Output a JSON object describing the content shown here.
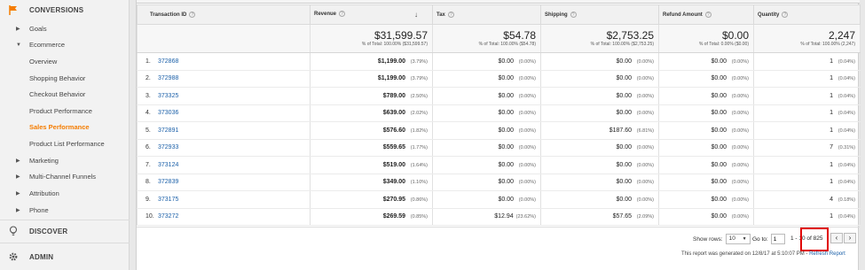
{
  "sidebar": {
    "conversions": "CONVERSIONS",
    "goals": "Goals",
    "ecommerce": "Ecommerce",
    "items": [
      "Overview",
      "Shopping Behavior",
      "Checkout Behavior",
      "Product Performance",
      "Sales Performance",
      "Product List Performance"
    ],
    "active_item": "Sales Performance",
    "marketing": "Marketing",
    "mcf": "Multi-Channel Funnels",
    "attribution": "Attribution",
    "phone": "Phone",
    "discover": "DISCOVER",
    "admin": "ADMIN"
  },
  "table": {
    "headers": [
      "Transaction ID",
      "Revenue",
      "Tax",
      "Shipping",
      "Refund Amount",
      "Quantity"
    ],
    "totals": [
      {
        "value": "$31,599.57",
        "pct": "% of Total: 100.00% ($31,599.57)"
      },
      {
        "value": "$54.78",
        "pct": "% of Total: 100.00% ($54.78)"
      },
      {
        "value": "$2,753.25",
        "pct": "% of Total: 100.00% ($2,753.25)"
      },
      {
        "value": "$0.00",
        "pct": "% of Total: 0.00% ($0.00)"
      },
      {
        "value": "2,247",
        "pct": "% of Total: 100.00% (2,247)"
      }
    ],
    "rows": [
      {
        "n": "1.",
        "id": "372868",
        "rev": "$1,199.00",
        "rev_p": "(3.79%)",
        "tax": "$0.00",
        "tax_p": "(0.00%)",
        "ship": "$0.00",
        "ship_p": "(0.00%)",
        "ref": "$0.00",
        "ref_p": "(0.00%)",
        "qty": "1",
        "qty_p": "(0.04%)"
      },
      {
        "n": "2.",
        "id": "372988",
        "rev": "$1,199.00",
        "rev_p": "(3.79%)",
        "tax": "$0.00",
        "tax_p": "(0.00%)",
        "ship": "$0.00",
        "ship_p": "(0.00%)",
        "ref": "$0.00",
        "ref_p": "(0.00%)",
        "qty": "1",
        "qty_p": "(0.04%)"
      },
      {
        "n": "3.",
        "id": "373325",
        "rev": "$789.00",
        "rev_p": "(2.50%)",
        "tax": "$0.00",
        "tax_p": "(0.00%)",
        "ship": "$0.00",
        "ship_p": "(0.00%)",
        "ref": "$0.00",
        "ref_p": "(0.00%)",
        "qty": "1",
        "qty_p": "(0.04%)"
      },
      {
        "n": "4.",
        "id": "373036",
        "rev": "$639.00",
        "rev_p": "(2.02%)",
        "tax": "$0.00",
        "tax_p": "(0.00%)",
        "ship": "$0.00",
        "ship_p": "(0.00%)",
        "ref": "$0.00",
        "ref_p": "(0.00%)",
        "qty": "1",
        "qty_p": "(0.04%)"
      },
      {
        "n": "5.",
        "id": "372891",
        "rev": "$576.60",
        "rev_p": "(1.82%)",
        "tax": "$0.00",
        "tax_p": "(0.00%)",
        "ship": "$187.60",
        "ship_p": "(6.81%)",
        "ref": "$0.00",
        "ref_p": "(0.00%)",
        "qty": "1",
        "qty_p": "(0.04%)"
      },
      {
        "n": "6.",
        "id": "372933",
        "rev": "$559.65",
        "rev_p": "(1.77%)",
        "tax": "$0.00",
        "tax_p": "(0.00%)",
        "ship": "$0.00",
        "ship_p": "(0.00%)",
        "ref": "$0.00",
        "ref_p": "(0.00%)",
        "qty": "7",
        "qty_p": "(0.31%)"
      },
      {
        "n": "7.",
        "id": "373124",
        "rev": "$519.00",
        "rev_p": "(1.64%)",
        "tax": "$0.00",
        "tax_p": "(0.00%)",
        "ship": "$0.00",
        "ship_p": "(0.00%)",
        "ref": "$0.00",
        "ref_p": "(0.00%)",
        "qty": "1",
        "qty_p": "(0.04%)"
      },
      {
        "n": "8.",
        "id": "372839",
        "rev": "$349.00",
        "rev_p": "(1.10%)",
        "tax": "$0.00",
        "tax_p": "(0.00%)",
        "ship": "$0.00",
        "ship_p": "(0.00%)",
        "ref": "$0.00",
        "ref_p": "(0.00%)",
        "qty": "1",
        "qty_p": "(0.04%)"
      },
      {
        "n": "9.",
        "id": "373175",
        "rev": "$270.95",
        "rev_p": "(0.86%)",
        "tax": "$0.00",
        "tax_p": "(0.00%)",
        "ship": "$0.00",
        "ship_p": "(0.00%)",
        "ref": "$0.00",
        "ref_p": "(0.00%)",
        "qty": "4",
        "qty_p": "(0.18%)"
      },
      {
        "n": "10.",
        "id": "373272",
        "rev": "$269.59",
        "rev_p": "(0.85%)",
        "tax": "$12.94",
        "tax_p": "(23.62%)",
        "ship": "$57.65",
        "ship_p": "(2.09%)",
        "ref": "$0.00",
        "ref_p": "(0.00%)",
        "qty": "1",
        "qty_p": "(0.04%)"
      }
    ]
  },
  "footer": {
    "show_rows_label": "Show rows:",
    "show_rows_value": "10",
    "goto_label": "Go to:",
    "goto_value": "1",
    "range": "1 - 10 of 825",
    "generated": "This report was generated on 12/8/17 at 5:10:07 PM - ",
    "refresh": "Refresh Report"
  },
  "colors": {
    "accent": "#f57c00",
    "link": "#1a5fa8",
    "highlight": "#e00000"
  }
}
